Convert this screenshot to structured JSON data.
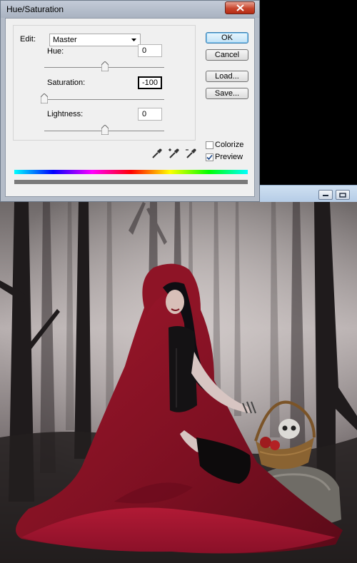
{
  "dialog": {
    "title": "Hue/Saturation",
    "edit": {
      "label": "Edit:",
      "value": "Master"
    },
    "hue": {
      "label": "Hue:",
      "value": "0"
    },
    "saturation": {
      "label": "Saturation:",
      "value": "-100"
    },
    "lightness": {
      "label": "Lightness:",
      "value": "0"
    },
    "buttons": {
      "ok": "OK",
      "cancel": "Cancel",
      "load": "Load...",
      "save": "Save..."
    },
    "colorize": {
      "label": "Colorize",
      "checked": false
    },
    "preview": {
      "label": "Preview",
      "checked": true
    }
  },
  "icons": {
    "close": "close-icon",
    "dropdown": "chevron-down-icon",
    "eyedroppers": [
      "eyedropper-icon",
      "eyedropper-plus-icon",
      "eyedropper-minus-icon"
    ],
    "window_controls": [
      "minimize-icon",
      "restore-icon"
    ]
  },
  "colors": {
    "close_button": "#c7452d",
    "default_button": "#3c7fb1",
    "cloak": "#8c1426",
    "fog": "#b9b2b1"
  },
  "photo": {
    "subject": "woman-in-red-cloak-with-basket"
  }
}
